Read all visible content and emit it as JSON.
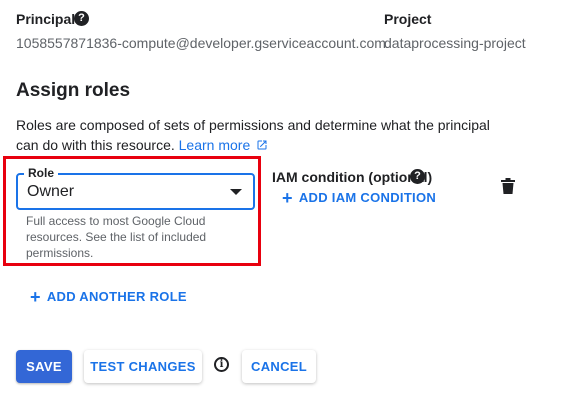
{
  "principal": {
    "label": "Principal",
    "value": "1058557871836-compute@developer.gserviceaccount.com"
  },
  "project": {
    "label": "Project",
    "value": "dataprocessing-project"
  },
  "assign_roles": {
    "title": "Assign roles",
    "description": "Roles are composed of sets of permissions and determine what the principal can do with this resource.",
    "learn_more": "Learn more"
  },
  "role": {
    "label": "Role",
    "value": "Owner",
    "description": "Full access to most Google Cloud resources. See the list of included permissions."
  },
  "iam_condition": {
    "label": "IAM condition (optional)",
    "add_label": "ADD IAM CONDITION"
  },
  "add_another_role": "ADD ANOTHER ROLE",
  "actions": {
    "save": "SAVE",
    "test_changes": "TEST CHANGES",
    "cancel": "CANCEL"
  },
  "icons": {
    "help": "help-icon",
    "external_link": "external-link-icon",
    "trash": "trash-icon",
    "info": "info-icon",
    "plus": "plus-icon",
    "dropdown": "caret-down-icon"
  },
  "colors": {
    "accent": "#1a73e8",
    "primary_button": "#3367d6",
    "highlight": "#e8000e"
  }
}
